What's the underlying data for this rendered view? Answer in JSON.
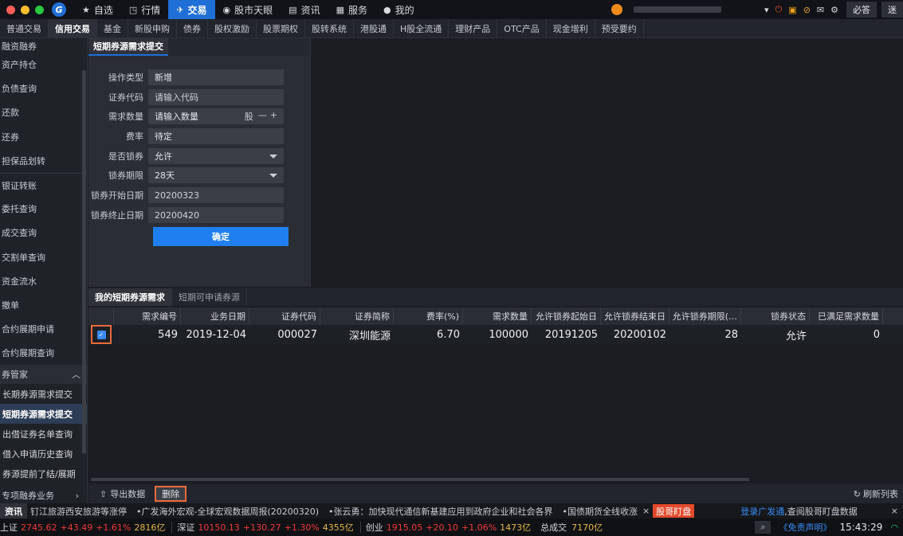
{
  "window": {
    "traffic_colors": [
      "#ff5f57",
      "#febc2e",
      "#28c840"
    ],
    "logo": "G"
  },
  "topnav": [
    {
      "icon": "★",
      "label": "自选"
    },
    {
      "icon": "◳",
      "label": "行情"
    },
    {
      "icon": "✈",
      "label": "交易",
      "active": true
    },
    {
      "icon": "◉",
      "label": "股市天眼"
    },
    {
      "icon": "▤",
      "label": "资讯"
    },
    {
      "icon": "▦",
      "label": "服务"
    },
    {
      "icon": "●",
      "label": "我的"
    }
  ],
  "topright": {
    "btn1": "必答",
    "btn2": "迷"
  },
  "subnav": [
    "普通交易",
    "信用交易",
    "基金",
    "新股申购",
    "债券",
    "股权激励",
    "股票期权",
    "股转系统",
    "港股通",
    "H股全流通",
    "理财产品",
    "OTC产品",
    "现金增利",
    "预受要约"
  ],
  "subnav_active": 1,
  "sidebar": {
    "cut_top": "融资融券",
    "items": [
      "资产持仓",
      "负债查询",
      "还款",
      "还券",
      "担保品划转",
      "银证转账",
      "委托查询",
      "成交查询",
      "交割单查询",
      "资金流水",
      "撤单",
      "合约展期申请",
      "合约展期查询"
    ],
    "group": "券管家",
    "group_icon": "︿",
    "sub_items": [
      "长期券源需求提交",
      "短期券源需求提交",
      "出借证券名单查询",
      "借入申请历史查询",
      "券源提前了结/展期"
    ],
    "sub_active": 1,
    "cut_bottom": "专项融券业务",
    "cut_bottom_icon": "›"
  },
  "form": {
    "tab": "短期券源需求提交",
    "rows": [
      {
        "label": "操作类型",
        "value": "新增",
        "type": "text"
      },
      {
        "label": "证券代码",
        "value": "请输入代码",
        "type": "input"
      },
      {
        "label": "需求数量",
        "value": "请输入数量",
        "type": "stepper",
        "unit": "股",
        "minus": "—",
        "plus": "+"
      },
      {
        "label": "费率",
        "value": "待定",
        "type": "text"
      },
      {
        "label": "是否锁券",
        "value": "允许",
        "type": "select"
      },
      {
        "label": "锁券期限",
        "value": "28天",
        "type": "select"
      },
      {
        "label": "锁券开始日期",
        "value": "20200323",
        "type": "input"
      },
      {
        "label": "锁券终止日期",
        "value": "20200420",
        "type": "input"
      }
    ],
    "confirm": "确定"
  },
  "lower_tabs": [
    "我的短期券源需求",
    "短期可申请券源"
  ],
  "table": {
    "columns": [
      "需求编号",
      "业务日期",
      "证券代码",
      "证券简称",
      "费率(%)",
      "需求数量",
      "允许锁券起始日",
      "允许锁券结束日",
      "允许锁券期限(…",
      "锁券状态",
      "已满足需求数量"
    ],
    "rows": [
      [
        "549",
        "2019-12-04",
        "000027",
        "深圳能源",
        "6.70",
        "100000",
        "20191205",
        "20200102",
        "28",
        "允许",
        "0"
      ]
    ]
  },
  "bottom": {
    "export": "导出数据",
    "delete": "删除",
    "refresh": "刷新列表"
  },
  "news": {
    "tag": "资讯",
    "items": [
      "钉江旅游西安旅游等涨停",
      "•广发海外宏观-全球宏观数据周报(20200320)",
      "•张云勇：加快现代通信新基建应用到政府企业和社会各界",
      "•国债期货全线收涨"
    ],
    "close": "×",
    "hot": "股哥盯盘",
    "login_link": "登录广发通",
    "login_text": ",查阅股哥盯盘数据",
    "end_x": "×"
  },
  "indices": [
    {
      "name": "上证",
      "value": "2745.62",
      "change": "+43.49",
      "pct": "+1.61%",
      "amount": "2816亿"
    },
    {
      "name": "深证",
      "value": "10150.13",
      "change": "+130.27",
      "pct": "+1.30%",
      "amount": "4355亿"
    },
    {
      "name": "创业",
      "value": "1915.05",
      "change": "+20.10",
      "pct": "+1.06%",
      "amount": "1473亿"
    }
  ],
  "total_label": "总成交",
  "total_value": "7170亿",
  "disclaimer": "《免责声明》",
  "time": "15:43:29"
}
